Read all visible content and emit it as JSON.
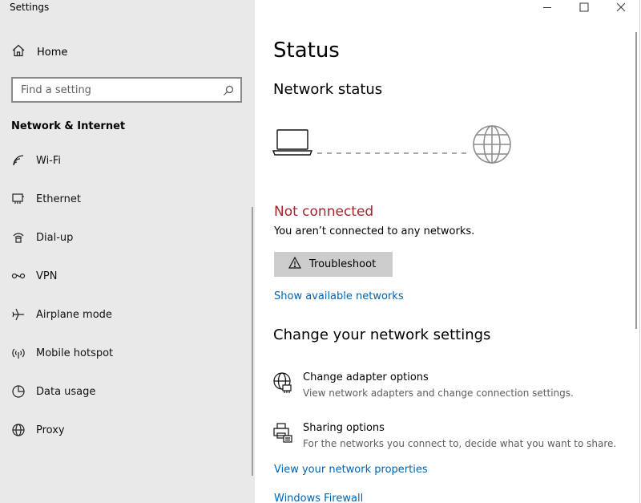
{
  "window": {
    "title": "Settings",
    "icons": {
      "minimize": "minimize-icon",
      "maximize": "maximize-icon",
      "close": "close-icon"
    }
  },
  "sidebar": {
    "home": {
      "label": "Home",
      "icon": "home-icon"
    },
    "search": {
      "placeholder": "Find a setting",
      "icon": "search-icon"
    },
    "section_title": "Network & Internet",
    "items": [
      {
        "label": "Wi-Fi",
        "icon": "wifi-icon"
      },
      {
        "label": "Ethernet",
        "icon": "ethernet-icon"
      },
      {
        "label": "Dial-up",
        "icon": "dialup-icon"
      },
      {
        "label": "VPN",
        "icon": "vpn-icon"
      },
      {
        "label": "Airplane mode",
        "icon": "airplane-icon"
      },
      {
        "label": "Mobile hotspot",
        "icon": "hotspot-icon"
      },
      {
        "label": "Data usage",
        "icon": "data-usage-icon"
      },
      {
        "label": "Proxy",
        "icon": "globe-icon"
      }
    ]
  },
  "main": {
    "title": "Status",
    "network_status_heading": "Network status",
    "diagram": {
      "device_icon": "laptop-icon",
      "internet_icon": "globe-icon"
    },
    "connection_state": "Not connected",
    "connection_desc": "You aren’t connected to any networks.",
    "troubleshoot": {
      "label": "Troubleshoot",
      "icon": "warning-icon"
    },
    "show_networks_link": "Show available networks",
    "change_heading": "Change your network settings",
    "options": [
      {
        "title": "Change adapter options",
        "subtitle": "View network adapters and change connection settings.",
        "icon": "adapter-icon"
      },
      {
        "title": "Sharing options",
        "subtitle": "For the networks you connect to, decide what you want to share.",
        "icon": "sharing-icon"
      }
    ],
    "properties_link": "View your network properties",
    "firewall_link": "Windows Firewall"
  },
  "colors": {
    "sidebar_bg": "#e9e9e9",
    "link": "#0063b1",
    "error": "#a4262c",
    "button_bg": "#cccccc"
  }
}
